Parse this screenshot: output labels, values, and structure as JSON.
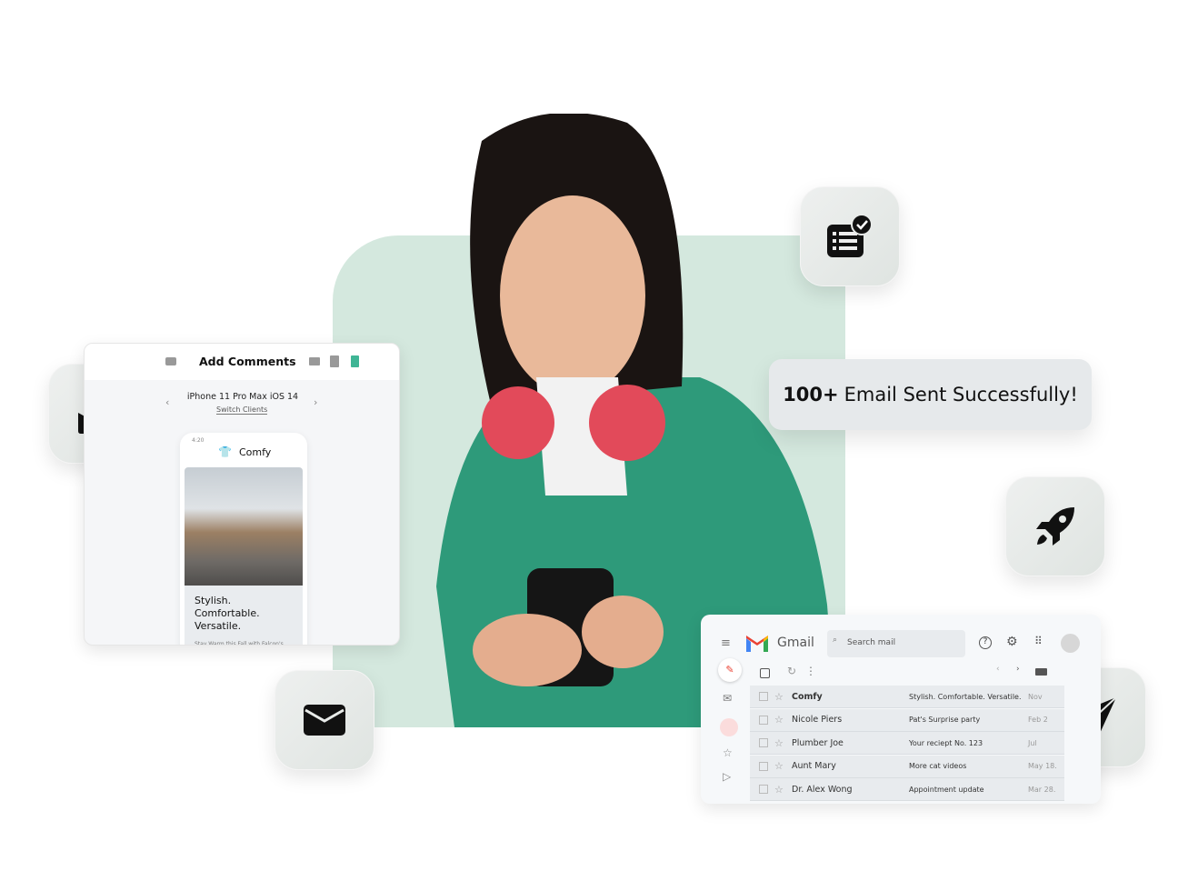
{
  "banner": {
    "count": "100+",
    "text": "Email Sent Successfully!"
  },
  "preview": {
    "title": "Add Comments",
    "device": "iPhone 11 Pro Max iOS 14",
    "switch": "Switch Clients",
    "time": "4:20",
    "brand": "Comfy",
    "headline": [
      "Stylish.",
      "Comfortable.",
      "Versatile."
    ],
    "body": "Stay Warm this Fall with Falcon's"
  },
  "gmail": {
    "app": "Gmail",
    "search_placeholder": "Search mail",
    "rows": [
      {
        "from": "Comfy",
        "subject": "Stylish. Comfortable. Versatile.",
        "date": "Nov"
      },
      {
        "from": "Nicole Piers",
        "subject": "Pat's Surprise party",
        "date": "Feb 2"
      },
      {
        "from": "Plumber Joe",
        "subject": "Your reciept No. 123",
        "date": "Jul"
      },
      {
        "from": "Aunt Mary",
        "subject": "More cat videos",
        "date": "May 18."
      },
      {
        "from": "Dr. Alex Wong",
        "subject": "Appointment update",
        "date": "Mar 28."
      }
    ]
  },
  "colors": {
    "accent_green": "#d4e8de",
    "jacket": "#2e9a7a",
    "device_active": "#3fb595",
    "gmail_red": "#ea4335"
  },
  "icons": [
    "clipboard-check-icon",
    "inbox-icon",
    "envelope-icon",
    "rocket-icon",
    "paper-plane-icon"
  ]
}
